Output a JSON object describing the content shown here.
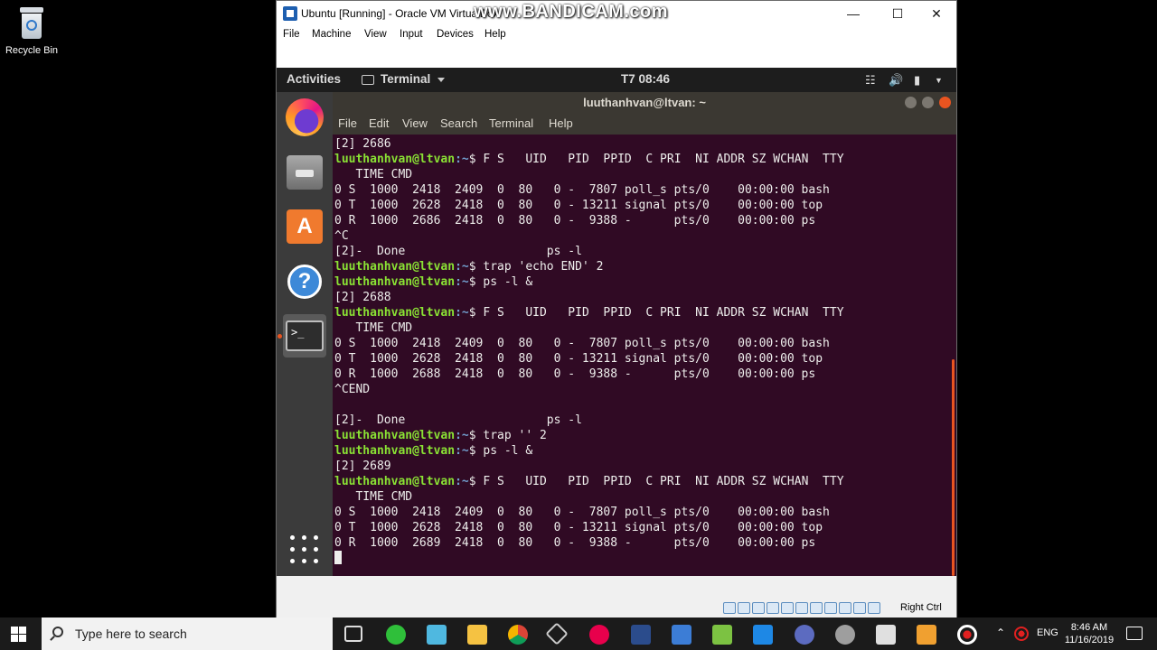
{
  "desktop": {
    "recycle_bin_label": "Recycle Bin"
  },
  "vbox": {
    "title": "Ubuntu [Running] - Oracle VM VirtualBox",
    "menu": [
      "File",
      "Machine",
      "View",
      "Input",
      "Devices",
      "Help"
    ],
    "status_host_key": "Right Ctrl"
  },
  "watermark": "www.BANDICAM.com",
  "gnome": {
    "activities": "Activities",
    "app_menu": "Terminal",
    "clock": "T7 08:46"
  },
  "terminal": {
    "title": "luuthanhvan@ltvan: ~",
    "menu": [
      "File",
      "Edit",
      "View",
      "Search",
      "Terminal",
      "Help"
    ],
    "prompt_user": "luuthanhvan@ltvan",
    "prompt_path": ":~",
    "lines": [
      {
        "text": "[2] 2686"
      },
      {
        "prompt": true,
        "text": "$ F S   UID   PID  PPID  C PRI  NI ADDR SZ WCHAN  TTY"
      },
      {
        "text": "   TIME CMD"
      },
      {
        "text": "0 S  1000  2418  2409  0  80   0 -  7807 poll_s pts/0    00:00:00 bash"
      },
      {
        "text": "0 T  1000  2628  2418  0  80   0 - 13211 signal pts/0    00:00:00 top"
      },
      {
        "text": "0 R  1000  2686  2418  0  80   0 -  9388 -      pts/0    00:00:00 ps"
      },
      {
        "text": "^C"
      },
      {
        "text": "[2]-  Done                    ps -l"
      },
      {
        "prompt": true,
        "text": "$ trap 'echo END' 2"
      },
      {
        "prompt": true,
        "text": "$ ps -l &"
      },
      {
        "text": "[2] 2688"
      },
      {
        "prompt": true,
        "text": "$ F S   UID   PID  PPID  C PRI  NI ADDR SZ WCHAN  TTY"
      },
      {
        "text": "   TIME CMD"
      },
      {
        "text": "0 S  1000  2418  2409  0  80   0 -  7807 poll_s pts/0    00:00:00 bash"
      },
      {
        "text": "0 T  1000  2628  2418  0  80   0 - 13211 signal pts/0    00:00:00 top"
      },
      {
        "text": "0 R  1000  2688  2418  0  80   0 -  9388 -      pts/0    00:00:00 ps"
      },
      {
        "text": "^CEND"
      },
      {
        "text": ""
      },
      {
        "text": "[2]-  Done                    ps -l"
      },
      {
        "prompt": true,
        "text": "$ trap '' 2"
      },
      {
        "prompt": true,
        "text": "$ ps -l &"
      },
      {
        "text": "[2] 2689"
      },
      {
        "prompt": true,
        "text": "$ F S   UID   PID  PPID  C PRI  NI ADDR SZ WCHAN  TTY"
      },
      {
        "text": "   TIME CMD"
      },
      {
        "text": "0 S  1000  2418  2409  0  80   0 -  7807 poll_s pts/0    00:00:00 bash"
      },
      {
        "text": "0 T  1000  2628  2418  0  80   0 - 13211 signal pts/0    00:00:00 top"
      },
      {
        "text": "0 R  1000  2689  2418  0  80   0 -  9388 -      pts/0    00:00:00 ps"
      }
    ]
  },
  "taskbar": {
    "search_placeholder": "Type here to search",
    "language": "ENG",
    "time": "8:46 AM",
    "date": "11/16/2019"
  }
}
